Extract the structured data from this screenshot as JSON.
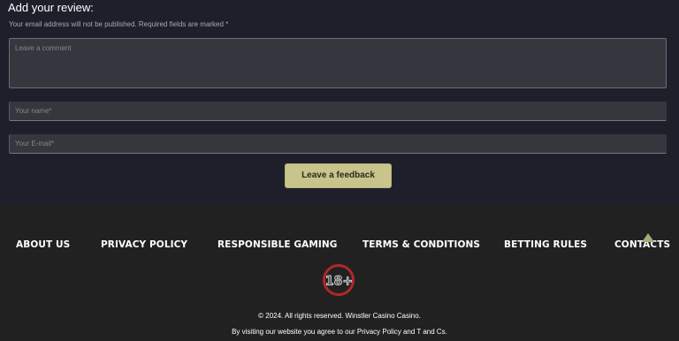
{
  "review": {
    "title": "Add your review:",
    "note": "Your email address will not be published. Required fields are marked *",
    "comment_placeholder": "Leave a comment",
    "name_placeholder": "Your name*",
    "email_placeholder": "Your E-mail*",
    "submit_label": "Leave a feedback"
  },
  "footer": {
    "nav": [
      {
        "label": "ABOUT US"
      },
      {
        "label": "PRIVACY POLICY"
      },
      {
        "label": "RESPONSIBLE GAMING"
      },
      {
        "label": "TERMS & CONDITIONS"
      },
      {
        "label": "BETTING RULES"
      },
      {
        "label": "CONTACTS"
      }
    ],
    "age_badge": "18+",
    "copyright": "© 2024. All rights reserved. Winstler Casino Casino.",
    "agreement": "By visiting our website you agree to our Privacy Policy and T and Cs.",
    "scroll_top_icon": "triangle-up-icon"
  },
  "colors": {
    "review_bg": "#1f1f2b",
    "footer_bg": "#212121",
    "button": "#c8c48b",
    "badge_red": "#b3262b"
  }
}
